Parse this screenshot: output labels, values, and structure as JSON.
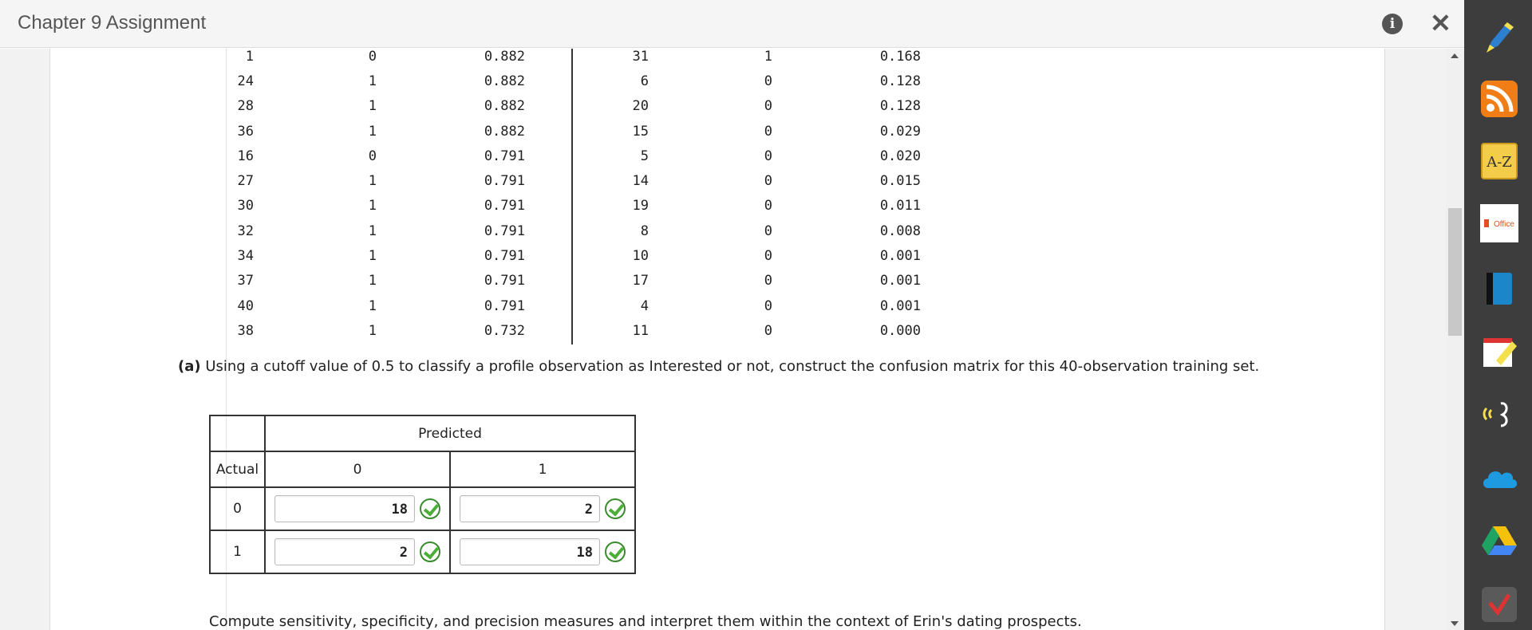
{
  "window": {
    "title": "Chapter 9 Assignment",
    "info_icon": "i",
    "close_icon": "✕"
  },
  "data_table": {
    "rows": [
      [
        "1",
        "0",
        "0.882",
        "31",
        "1",
        "0.168"
      ],
      [
        "24",
        "1",
        "0.882",
        "6",
        "0",
        "0.128"
      ],
      [
        "28",
        "1",
        "0.882",
        "20",
        "0",
        "0.128"
      ],
      [
        "36",
        "1",
        "0.882",
        "15",
        "0",
        "0.029"
      ],
      [
        "16",
        "0",
        "0.791",
        "5",
        "0",
        "0.020"
      ],
      [
        "27",
        "1",
        "0.791",
        "14",
        "0",
        "0.015"
      ],
      [
        "30",
        "1",
        "0.791",
        "19",
        "0",
        "0.011"
      ],
      [
        "32",
        "1",
        "0.791",
        "8",
        "0",
        "0.008"
      ],
      [
        "34",
        "1",
        "0.791",
        "10",
        "0",
        "0.001"
      ],
      [
        "37",
        "1",
        "0.791",
        "17",
        "0",
        "0.001"
      ],
      [
        "40",
        "1",
        "0.791",
        "4",
        "0",
        "0.001"
      ],
      [
        "38",
        "1",
        "0.732",
        "11",
        "0",
        "0.000"
      ]
    ]
  },
  "question_a": {
    "label": "(a)",
    "text": "Using a cutoff value of 0.5 to classify a profile observation as Interested or not, construct the confusion matrix for this 40-observation training set."
  },
  "confusion_matrix": {
    "predicted_header": "Predicted",
    "actual_header": "Actual",
    "col_0": "0",
    "col_1": "1",
    "row_0_label": "0",
    "row_1_label": "1",
    "cells": {
      "r0c0": "18",
      "r0c1": "2",
      "r1c0": "2",
      "r1c1": "18"
    }
  },
  "followup_text": "Compute sensitivity, specificity, and precision measures and interpret them within the context of Erin's dating prospects.",
  "toolbar": {
    "icons": [
      "highlighter-icon",
      "rss-icon",
      "a-z-icon",
      "office-icon",
      "book-icon",
      "note-icon",
      "speech-icon",
      "cloud-icon",
      "drive-icon",
      "app-icon"
    ],
    "az_label": "A-Z",
    "office_label": "Office"
  },
  "colors": {
    "check_green": "#4cae38",
    "rss_orange": "#f07d15",
    "cloud_blue": "#1e9be0",
    "toolbar_bg": "#3d3d3d"
  }
}
